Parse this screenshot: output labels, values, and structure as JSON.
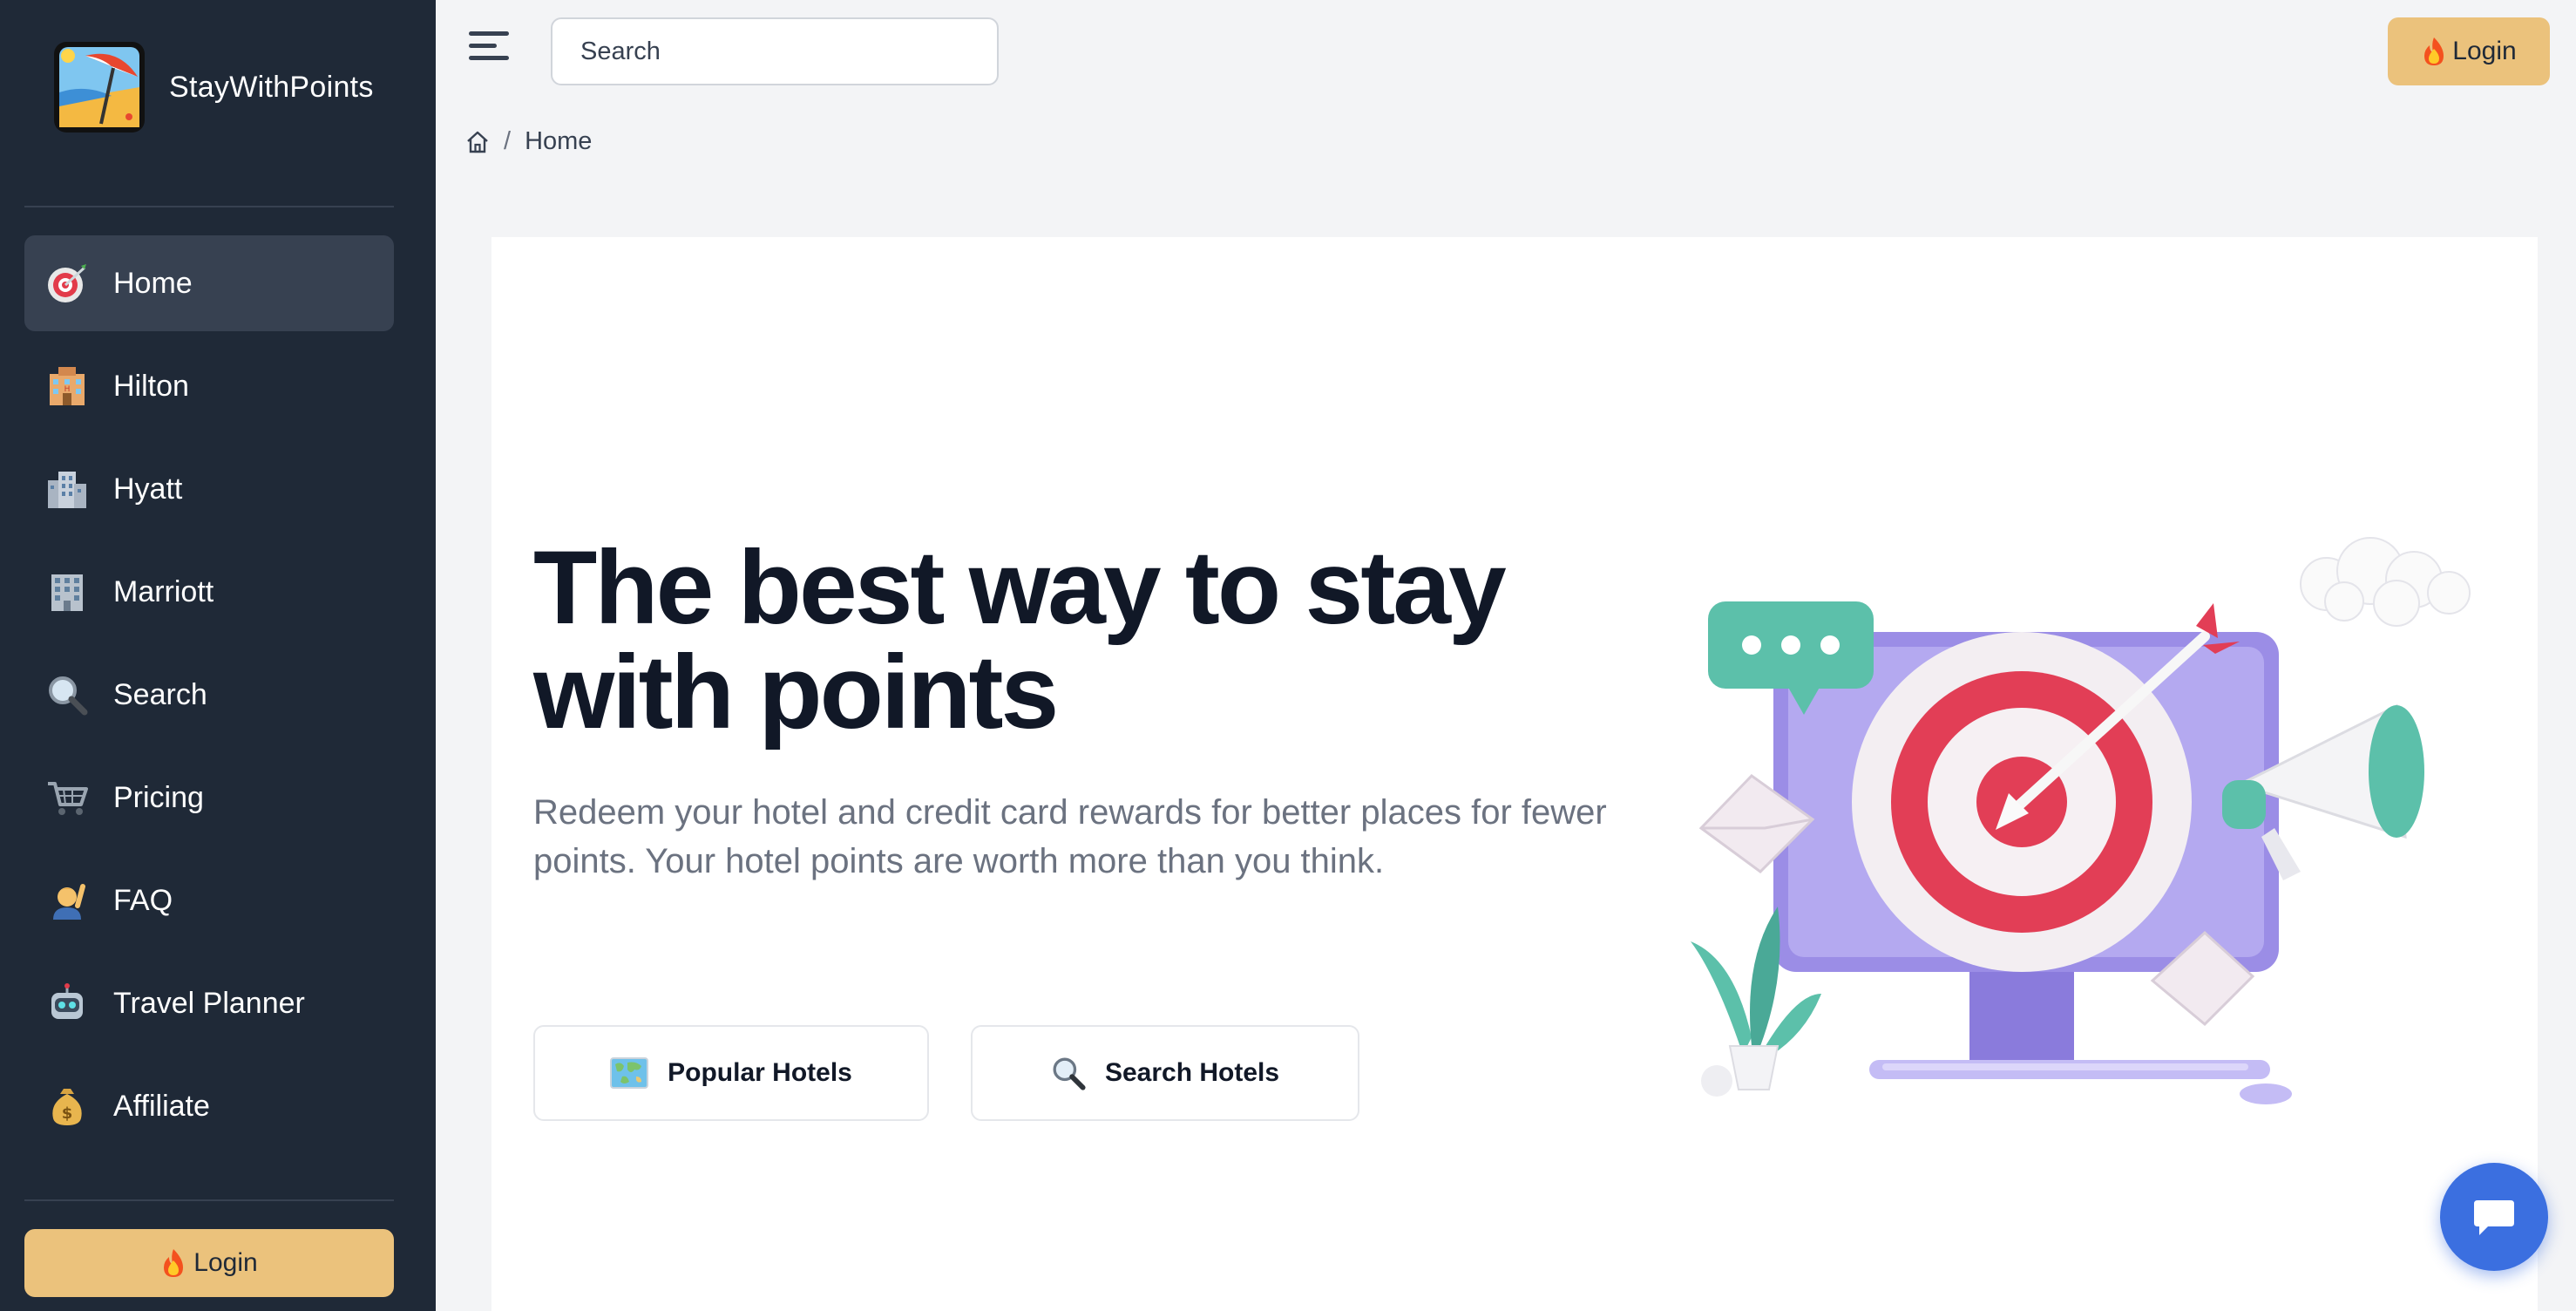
{
  "brand": {
    "name": "StayWithPoints",
    "logo_icon": "beach-umbrella-icon"
  },
  "sidebar": {
    "items": [
      {
        "label": "Home",
        "icon": "target-icon",
        "active": true
      },
      {
        "label": "Hilton",
        "icon": "hotel-icon"
      },
      {
        "label": "Hyatt",
        "icon": "building-icon"
      },
      {
        "label": "Marriott",
        "icon": "office-building-icon"
      },
      {
        "label": "Search",
        "icon": "magnifier-icon"
      },
      {
        "label": "Pricing",
        "icon": "shopping-cart-icon"
      },
      {
        "label": "FAQ",
        "icon": "person-raising-hand-icon"
      },
      {
        "label": "Travel Planner",
        "icon": "robot-icon"
      },
      {
        "label": "Affiliate",
        "icon": "money-bag-icon"
      }
    ],
    "login_label": "Login"
  },
  "header": {
    "search_placeholder": "Search",
    "login_label": "Login"
  },
  "breadcrumb": {
    "current": "Home"
  },
  "hero": {
    "title": "The best way to stay with points",
    "subtitle": "Redeem your hotel and credit card rewards for better places for fewer points. Your hotel points are worth more than you think.",
    "buttons": [
      {
        "label": "Popular Hotels",
        "icon": "world-map-icon"
      },
      {
        "label": "Search Hotels",
        "icon": "magnifier-icon"
      }
    ]
  },
  "colors": {
    "sidebar_bg": "#1f2937",
    "active_item_bg": "#374151",
    "login_bg": "#ebc27c",
    "chat_button": "#3b6fe0"
  }
}
